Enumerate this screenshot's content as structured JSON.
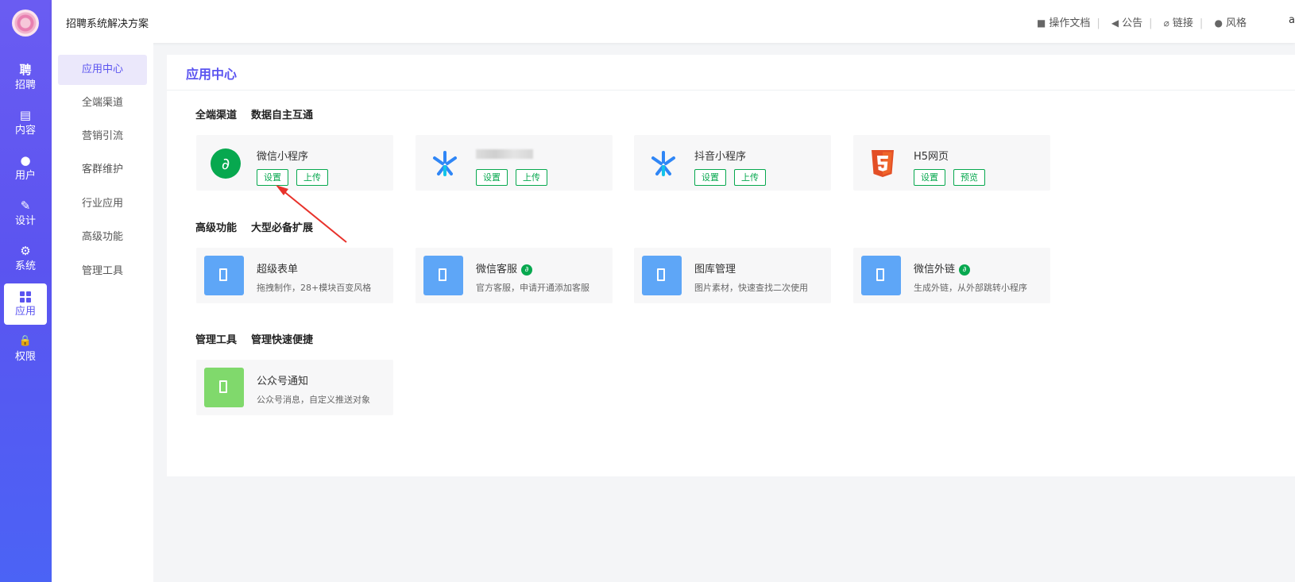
{
  "nav": {
    "items": [
      {
        "label": "招聘",
        "icon": "聘"
      },
      {
        "label": "内容",
        "icon": "▤"
      },
      {
        "label": "用户",
        "icon": "●"
      },
      {
        "label": "设计",
        "icon": "✎"
      },
      {
        "label": "系统",
        "icon": "⚙"
      },
      {
        "label": "应用",
        "icon": "grid"
      },
      {
        "label": "权限",
        "icon": "🔒"
      }
    ]
  },
  "header": {
    "title": "招聘系统解决方案",
    "links": {
      "docs": "操作文档",
      "notice": "公告",
      "link": "链接",
      "style": "风格"
    },
    "user_initial": "a"
  },
  "subnav": {
    "items": [
      "应用中心",
      "全端渠道",
      "营销引流",
      "客群维护",
      "行业应用",
      "高级功能",
      "管理工具"
    ]
  },
  "panel": {
    "title": "应用中心",
    "sections": [
      {
        "title": "全端渠道",
        "subtitle": "数据自主互通"
      },
      {
        "title": "高级功能",
        "subtitle": "大型必备扩展"
      },
      {
        "title": "管理工具",
        "subtitle": "管理快速便捷"
      }
    ]
  },
  "channels": [
    {
      "name": "微信小程序",
      "buttons": [
        "设置",
        "上传"
      ],
      "icon": "wechat-miniprogram-icon"
    },
    {
      "name": "",
      "buttons": [
        "设置",
        "上传"
      ],
      "icon": "blue-star-icon"
    },
    {
      "name": "抖音小程序",
      "buttons": [
        "设置",
        "上传"
      ],
      "icon": "blue-star-icon"
    },
    {
      "name": "H5网页",
      "buttons": [
        "设置",
        "预览"
      ],
      "icon": "html5-icon"
    }
  ],
  "advanced": [
    {
      "name": "超级表单",
      "desc": "拖拽制作，28+模块百变风格"
    },
    {
      "name": "微信客服",
      "desc": "官方客服，申请开通添加客服",
      "badge": true
    },
    {
      "name": "图库管理",
      "desc": "图片素材，快速查找二次使用"
    },
    {
      "name": "微信外链",
      "desc": "生成外链，从外部跳转小程序",
      "badge": true
    }
  ],
  "tools": [
    {
      "name": "公众号通知",
      "desc": "公众号消息，自定义推送对象"
    }
  ],
  "colors": {
    "accent": "#5b54f0",
    "green": "#07a84f",
    "tile_blue": "#5ea6f7",
    "tile_green": "#80d96c"
  }
}
